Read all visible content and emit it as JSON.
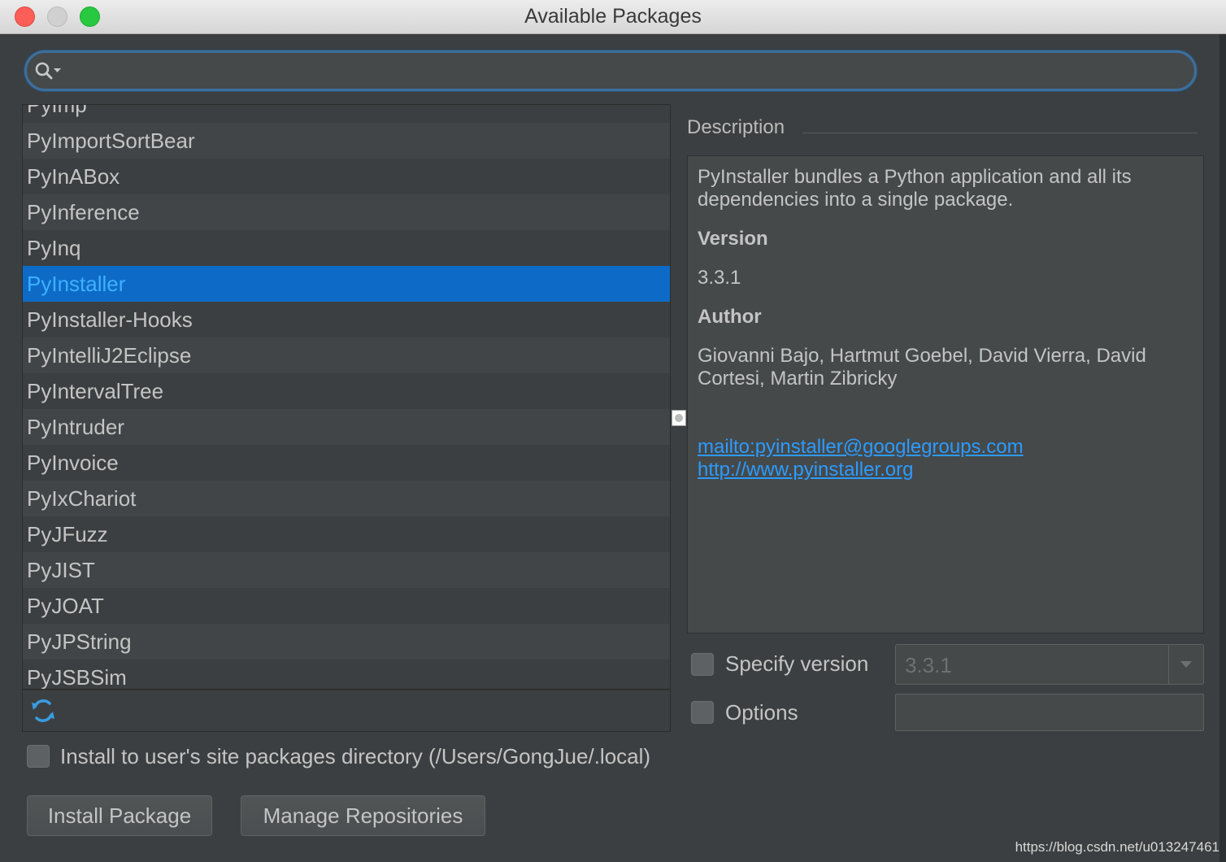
{
  "window": {
    "title": "Available Packages"
  },
  "search": {
    "value": "",
    "placeholder": ""
  },
  "packages": [
    "PyImp",
    "PyImportSortBear",
    "PyInABox",
    "PyInference",
    "PyInq",
    "PyInstaller",
    "PyInstaller-Hooks",
    "PyIntelliJ2Eclipse",
    "PyIntervalTree",
    "PyIntruder",
    "PyInvoice",
    "PyIxChariot",
    "PyJFuzz",
    "PyJIST",
    "PyJOAT",
    "PyJPString",
    "PyJSBSim"
  ],
  "selected_package": "PyInstaller",
  "description": {
    "label": "Description",
    "text": "PyInstaller bundles a Python application and all its dependencies into a single package.",
    "version_heading": "Version",
    "version": "3.3.1",
    "author_heading": "Author",
    "author": "Giovanni Bajo, Hartmut Goebel, David Vierra, David Cortesi, Martin Zibricky",
    "email_link": "mailto:pyinstaller@googlegroups.com",
    "homepage_link": "http://www.pyinstaller.org"
  },
  "specify_version": {
    "label": "Specify version",
    "checked": false,
    "value": "3.3.1"
  },
  "options": {
    "label": "Options",
    "checked": false,
    "value": ""
  },
  "install_user": {
    "label": "Install to user's site packages directory (/Users/GongJue/.local)",
    "checked": false
  },
  "buttons": {
    "install": "Install Package",
    "manage": "Manage Repositories"
  },
  "watermark": "https://blog.csdn.net/u013247461",
  "colors": {
    "selection": "#0d6bc7",
    "selected_text": "#3fb0ff",
    "link": "#2c9bff",
    "background": "#3c3f41"
  },
  "icons": {
    "search": "search-icon",
    "refresh": "refresh-icon",
    "dropdown": "chevron-down-icon"
  }
}
